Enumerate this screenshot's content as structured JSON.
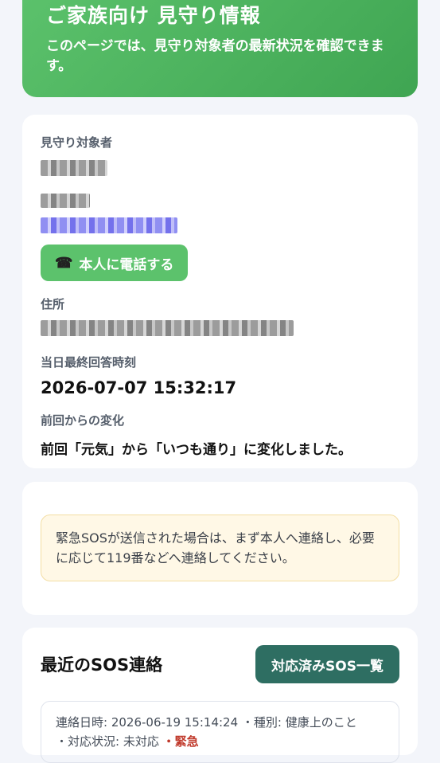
{
  "hero": {
    "title": "ご家族向け 見守り情報",
    "description": "このページでは、見守り対象者の最新状況を確認できます。"
  },
  "person": {
    "label": "見守り対象者",
    "call_button": "本人に電話する",
    "address_label": "住所",
    "last_answer_label": "当日最終回答時刻",
    "last_answer_time": "2026-07-07 15:32:17",
    "change_label": "前回からの変化",
    "change_text": "前回「元気」から「いつも通り」に変化しました。"
  },
  "notice": {
    "text": "緊急SOSが送信された場合は、まず本人へ連絡し、必要に応じて119番などへ連絡してください。"
  },
  "sos": {
    "title": "最近のSOS連絡",
    "handled_button": "対応済みSOS一覧",
    "items": [
      {
        "datetime": "連絡日時: 2026-06-19 15:14:24",
        "type": "・種別: 健康上のこと",
        "status": "・対応状況: 未対応",
        "urgency": "・緊急"
      }
    ]
  },
  "colors": {
    "accent_green": "#5cc26c",
    "dark_teal": "#2e6e62",
    "urgent_red": "#c0392b"
  }
}
